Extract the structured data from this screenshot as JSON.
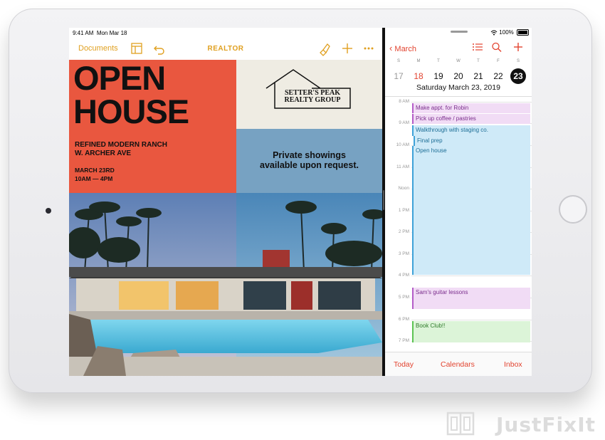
{
  "status_bar": {
    "time": "9:41 AM",
    "date": "Mon Mar 18",
    "battery": "100%"
  },
  "pages_app": {
    "back_label": "Documents",
    "doc_title": "REALTOR",
    "flyer": {
      "headline_line1": "OPEN",
      "headline_line2": "HOUSE",
      "subtitle_line1": "REFINED MODERN RANCH",
      "subtitle_line2": "W. ARCHER AVE",
      "date_line1": "MARCH 23RD",
      "date_line2": "10AM — 4PM",
      "logo_line1": "SETTER'S PEAK",
      "logo_line2": "REALTY GROUP",
      "showings_line1": "Private showings",
      "showings_line2": "available upon request."
    }
  },
  "calendar_app": {
    "back_label": "March",
    "week_headers": [
      "S",
      "M",
      "T",
      "W",
      "T",
      "F",
      "S"
    ],
    "week_days": [
      "17",
      "18",
      "19",
      "20",
      "21",
      "22",
      "23"
    ],
    "selected_date": "Saturday   March 23, 2019",
    "hours": [
      "8 AM",
      "9 AM",
      "10 AM",
      "11 AM",
      "Noon",
      "1 PM",
      "2 PM",
      "3 PM",
      "4 PM",
      "5 PM",
      "6 PM",
      "7 PM"
    ],
    "events": [
      "Make appt. for Robin",
      "Pick up coffee / pastries",
      "Walkthrough with staging co.",
      "Final prep",
      "Open house",
      "Sam's guitar lessons",
      "Book Club!!"
    ],
    "bottom_tabs": {
      "today": "Today",
      "calendars": "Calendars",
      "inbox": "Inbox"
    }
  },
  "watermark": "JustFixIt",
  "colors": {
    "pages_accent": "#e0a020",
    "calendar_accent": "#e2432f",
    "flyer_red": "#e9573f",
    "flyer_blue": "#77a2c2"
  }
}
